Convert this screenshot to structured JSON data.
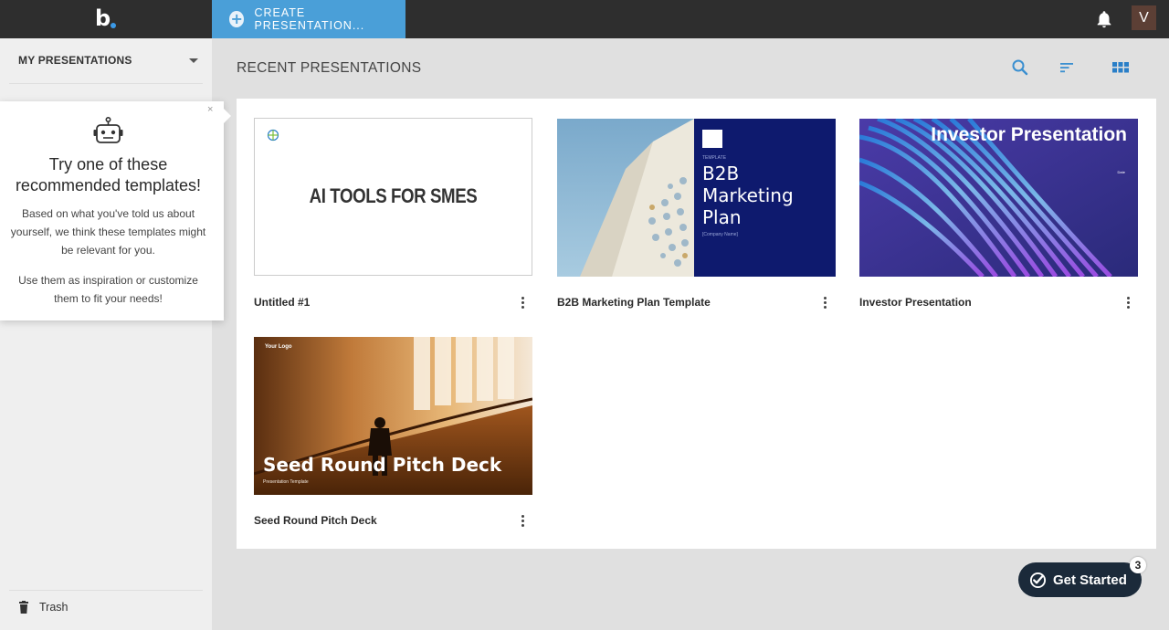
{
  "topbar": {
    "logo_text": "b",
    "create_button_label": "CREATE PRESENTATION...",
    "avatar_initial": "V",
    "bell_icon": "bell-icon"
  },
  "sidebar": {
    "section_label": "MY PRESENTATIONS",
    "trash_label": "Trash"
  },
  "popover": {
    "close_label": "×",
    "title": "Try one of these recommended templates!",
    "paragraph1": "Based on what you've told us about yourself, we think these templates might be relevant for you.",
    "paragraph2": "Use them as inspiration or customize them to fit your needs!"
  },
  "main": {
    "title": "RECENT PRESENTATIONS",
    "toolbar_icons": [
      "search-icon",
      "sort-icon",
      "grid-view-icon"
    ],
    "cards": [
      {
        "name": "Untitled #1",
        "thumb_text": "AI TOOLS FOR SMES"
      },
      {
        "name": "B2B Marketing Plan Template",
        "thumb_small": "TEMPLATE",
        "thumb_title": "B2B Marketing Plan",
        "thumb_sub": "[Company Name]"
      },
      {
        "name": "Investor Presentation",
        "thumb_title": "Investor Presentation",
        "thumb_sub": "Date"
      },
      {
        "name": "Seed Round Pitch Deck",
        "thumb_logo": "Your Logo",
        "thumb_title": "Seed Round Pitch Deck",
        "thumb_sub": "Presentation Template"
      }
    ]
  },
  "get_started": {
    "label": "Get Started",
    "badge": "3"
  },
  "colors": {
    "topbar": "#2e2e2e",
    "accent": "#4a9fd8",
    "get_started_bg": "#1b2a3a"
  }
}
